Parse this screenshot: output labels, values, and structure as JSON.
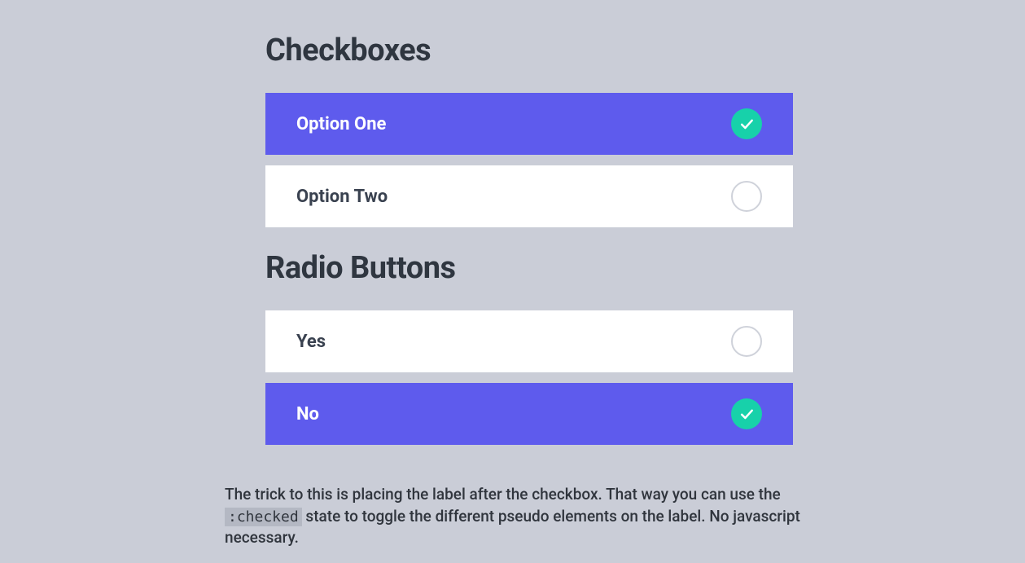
{
  "checkboxes": {
    "heading": "Checkboxes",
    "options": [
      {
        "label": "Option One",
        "checked": true
      },
      {
        "label": "Option Two",
        "checked": false
      }
    ]
  },
  "radio": {
    "heading": "Radio Buttons",
    "options": [
      {
        "label": "Yes",
        "checked": false
      },
      {
        "label": "No",
        "checked": true
      }
    ]
  },
  "explanation": {
    "part1": "The trick to this is placing the label after the checkbox. That way you can use the ",
    "code": ":checked",
    "part2": " state to toggle the different pseudo elements on the label. No javascript necessary."
  }
}
